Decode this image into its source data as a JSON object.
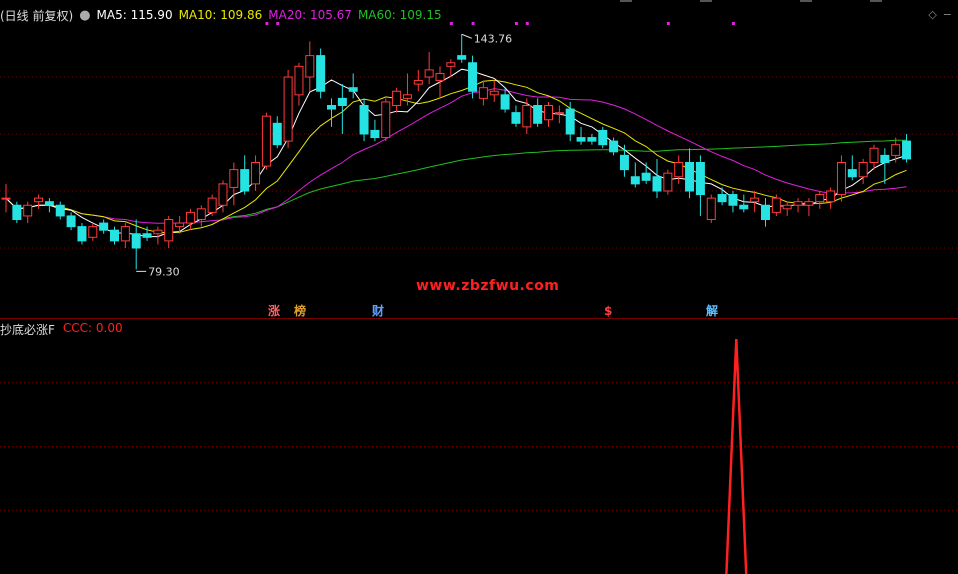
{
  "header": {
    "period": "(日线 前复权)",
    "ma5": "MA5: 115.90",
    "ma10": "MA10: 109.86",
    "ma20": "MA20: 105.67",
    "ma60": "MA60: 109.15"
  },
  "sub_header": {
    "title": "抄底必涨F",
    "value": "CCC: 0.00"
  },
  "annotations": {
    "high": "143.76",
    "low": "79.30"
  },
  "events": [
    "涨",
    "榜",
    "财",
    "$",
    "解"
  ],
  "watermark": "www.zbzfwu.com",
  "colors": {
    "up": "#ff3a3a",
    "down": "#26e3e3",
    "ma5": "#ffffff",
    "ma10": "#e8e800",
    "ma20": "#e020e0",
    "ma60": "#20c020",
    "ccc": "#ff2020",
    "grid": "#7a0000"
  },
  "chart_data": [
    {
      "type": "candlestick",
      "title": "",
      "ylim": [
        70,
        150
      ],
      "candles": [
        [
          100,
          104,
          96,
          100
        ],
        [
          98,
          99,
          93,
          94
        ],
        [
          95,
          99,
          93,
          98
        ],
        [
          99,
          101,
          97,
          100
        ],
        [
          99,
          100,
          96,
          98
        ],
        [
          98,
          99,
          94,
          95
        ],
        [
          95,
          96,
          91,
          92
        ],
        [
          92,
          93,
          87,
          88
        ],
        [
          89,
          93,
          88,
          92
        ],
        [
          93,
          94,
          90,
          91
        ],
        [
          91,
          92,
          87,
          88
        ],
        [
          88,
          93,
          86,
          92
        ],
        [
          90,
          94,
          80,
          86
        ],
        [
          90,
          92,
          88,
          89
        ],
        [
          90,
          92,
          87,
          91
        ],
        [
          88,
          95,
          86,
          94
        ],
        [
          92,
          95,
          90,
          93
        ],
        [
          93,
          97,
          91,
          96
        ],
        [
          94,
          98,
          92,
          97
        ],
        [
          96,
          101,
          95,
          100
        ],
        [
          98,
          105,
          96,
          104
        ],
        [
          103,
          110,
          98,
          108
        ],
        [
          108,
          112,
          101,
          102
        ],
        [
          104,
          112,
          102,
          110
        ],
        [
          109,
          124,
          108,
          123
        ],
        [
          121,
          123,
          114,
          115
        ],
        [
          116,
          136,
          114,
          134
        ],
        [
          129,
          138,
          126,
          137
        ],
        [
          134,
          144,
          130,
          140
        ],
        [
          140,
          142,
          128,
          130
        ],
        [
          126,
          128,
          120,
          125
        ],
        [
          128,
          132,
          118,
          126
        ],
        [
          131,
          135,
          128,
          130
        ],
        [
          126,
          128,
          116,
          118
        ],
        [
          119,
          122,
          116,
          117
        ],
        [
          117,
          128,
          116,
          127
        ],
        [
          126,
          131,
          124,
          130
        ],
        [
          128,
          135,
          126,
          129
        ],
        [
          132,
          136,
          130,
          133
        ],
        [
          134,
          141,
          132,
          136
        ],
        [
          133,
          137,
          128,
          135
        ],
        [
          137,
          139,
          134,
          138
        ],
        [
          140,
          146,
          138,
          139
        ],
        [
          138,
          140,
          128,
          130
        ],
        [
          128,
          133,
          126,
          131
        ],
        [
          129,
          133,
          127,
          130
        ],
        [
          129,
          131,
          124,
          125
        ],
        [
          124,
          126,
          120,
          121
        ],
        [
          120,
          128,
          118,
          126
        ],
        [
          126,
          128,
          120,
          121
        ],
        [
          122,
          127,
          120,
          126
        ],
        [
          124,
          126,
          121,
          124
        ],
        [
          125,
          127,
          116,
          118
        ],
        [
          117,
          120,
          115,
          116
        ],
        [
          117,
          118,
          115,
          116
        ],
        [
          119,
          120,
          114,
          115
        ],
        [
          116,
          117,
          112,
          113
        ],
        [
          112,
          115,
          106,
          108
        ],
        [
          106,
          110,
          103,
          104
        ],
        [
          107,
          110,
          104,
          105
        ],
        [
          106,
          111,
          100,
          102
        ],
        [
          102,
          108,
          101,
          107
        ],
        [
          106,
          112,
          104,
          110
        ],
        [
          110,
          114,
          100,
          102
        ],
        [
          110,
          112,
          95,
          101
        ],
        [
          94,
          101,
          93,
          100
        ],
        [
          101,
          103,
          98,
          99
        ],
        [
          101,
          102,
          96,
          98
        ],
        [
          98,
          101,
          96,
          97
        ],
        [
          99,
          102,
          96,
          100
        ],
        [
          98,
          100,
          92,
          94
        ],
        [
          96,
          101,
          95,
          100
        ],
        [
          97,
          99,
          95,
          98
        ],
        [
          98,
          100,
          96,
          99
        ],
        [
          98,
          100,
          95,
          99
        ],
        [
          99,
          102,
          97,
          101
        ],
        [
          99,
          103,
          97,
          102
        ],
        [
          101,
          112,
          99,
          110
        ],
        [
          108,
          112,
          105,
          106
        ],
        [
          106,
          111,
          104,
          110
        ],
        [
          110,
          115,
          108,
          114
        ],
        [
          112,
          114,
          104,
          110
        ],
        [
          112,
          117,
          110,
          115
        ],
        [
          116,
          118,
          110,
          111
        ]
      ]
    },
    {
      "type": "line",
      "title": "",
      "series": [
        {
          "name": "CCC",
          "values": [
            0,
            0,
            0,
            0,
            0,
            0,
            0,
            0,
            0,
            0,
            0,
            0,
            0,
            0,
            0,
            0,
            0,
            0,
            0,
            0,
            0,
            0,
            0,
            0,
            0,
            0,
            0,
            0,
            0,
            0,
            0,
            0,
            0,
            0,
            0,
            0,
            0,
            0,
            0,
            0,
            0,
            0,
            0,
            0,
            0,
            0,
            0,
            0,
            0,
            0,
            0,
            0,
            0,
            0,
            0,
            0,
            0,
            0,
            0,
            0,
            0,
            0,
            0,
            0,
            0,
            0,
            0,
            0,
            0,
            0,
            0,
            0,
            0,
            0,
            0,
            0,
            0,
            0,
            0,
            0,
            0,
            0,
            0,
            0
          ]
        }
      ],
      "spike": {
        "index": 58,
        "value": 1
      }
    }
  ]
}
